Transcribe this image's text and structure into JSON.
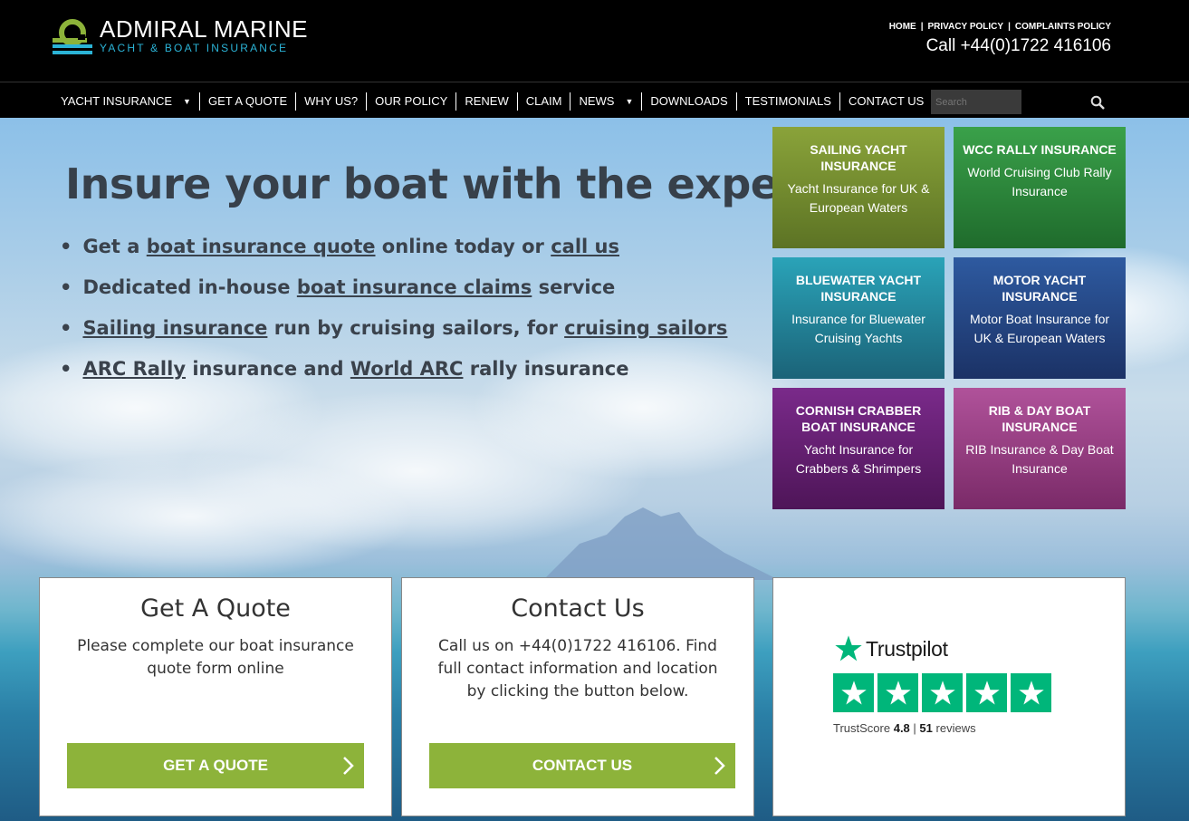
{
  "brand": {
    "name": "ADMIRAL MARINE",
    "tagline": "YACHT & BOAT INSURANCE",
    "colors": {
      "accent": "#2bb3d6",
      "logo_green": "#8db33a"
    }
  },
  "top_links": [
    "HOME",
    "PRIVACY POLICY",
    "COMPLAINTS POLICY"
  ],
  "phone": "Call +44(0)1722 416106",
  "nav": {
    "items": [
      {
        "label": "YACHT INSURANCE",
        "dropdown": true
      },
      {
        "label": "GET A QUOTE"
      },
      {
        "label": "WHY US?"
      },
      {
        "label": "OUR POLICY"
      },
      {
        "label": "RENEW"
      },
      {
        "label": "CLAIM"
      },
      {
        "label": "NEWS",
        "dropdown": true
      },
      {
        "label": "DOWNLOADS"
      },
      {
        "label": "TESTIMONIALS"
      },
      {
        "label": "CONTACT US"
      }
    ],
    "search_placeholder": "Search",
    "search_icon": "search-icon"
  },
  "hero": {
    "title": "Insure your boat with the experts",
    "bullets": [
      {
        "parts": [
          {
            "t": "Get a "
          },
          {
            "t": "boat insurance quote",
            "link": true
          },
          {
            "t": " online today or "
          },
          {
            "t": "call us",
            "link": true
          }
        ]
      },
      {
        "parts": [
          {
            "t": "Dedicated in-house "
          },
          {
            "t": "boat insurance claims",
            "link": true
          },
          {
            "t": " service"
          }
        ]
      },
      {
        "parts": [
          {
            "t": "Sailing insurance",
            "link": true
          },
          {
            "t": " run by cruising sailors, for "
          },
          {
            "t": "cruising sailors",
            "link": true
          }
        ]
      },
      {
        "parts": [
          {
            "t": "ARC Rally",
            "link": true
          },
          {
            "t": " insurance and "
          },
          {
            "t": "World ARC",
            "link": true
          },
          {
            "t": " rally insurance"
          }
        ]
      }
    ]
  },
  "tiles": [
    {
      "title": "SAILING YACHT INSURANCE",
      "desc": "Yacht Insurance for UK & European Waters",
      "color_top": "#8aa33a",
      "color_bottom": "#5c7324"
    },
    {
      "title": "WCC RALLY INSURANCE",
      "desc": "World Cruising Club Rally Insurance",
      "color_top": "#3aa14a",
      "color_bottom": "#1f6b2c"
    },
    {
      "title": "BLUEWATER YACHT INSURANCE",
      "desc": "Insurance for Bluewater Cruising Yachts",
      "color_top": "#2aa3b8",
      "color_bottom": "#1b6378"
    },
    {
      "title": "MOTOR YACHT INSURANCE",
      "desc": "Motor Boat Insurance for UK & European Waters",
      "color_top": "#2e5aa0",
      "color_bottom": "#1b3266"
    },
    {
      "title": "CORNISH CRABBER BOAT INSURANCE",
      "desc": "Yacht Insurance for Crabbers & Shrimpers",
      "color_top": "#7a2a8a",
      "color_bottom": "#4e1558"
    },
    {
      "title": "RIB & DAY BOAT INSURANCE",
      "desc": "RIB Insurance & Day Boat Insurance",
      "color_top": "#b0529a",
      "color_bottom": "#7a2a68"
    }
  ],
  "cards": {
    "quote": {
      "title": "Get A Quote",
      "text": "Please complete our boat insurance quote form online",
      "button": "GET A QUOTE"
    },
    "contact": {
      "title": "Contact Us",
      "text": "Call us on +44(0)1722 416106. Find full contact information and location by clicking the button below.",
      "button": "CONTACT US"
    }
  },
  "trustpilot": {
    "brand": "Trustpilot",
    "score_label": "TrustScore",
    "score": "4.8",
    "reviews_count": "51",
    "reviews_label": "reviews",
    "stars": 5,
    "color": "#00b67a"
  }
}
